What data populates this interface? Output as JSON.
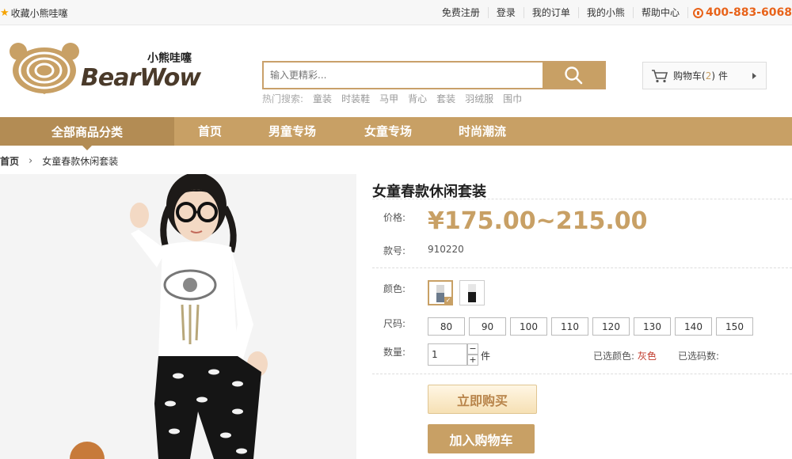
{
  "topbar": {
    "favorite": "收藏小熊哇噻",
    "links": [
      "免费注册",
      "登录",
      "我的订单",
      "我的小熊",
      "帮助中心"
    ],
    "phone": "400-883-6068"
  },
  "logo": {
    "brand": "BearWow",
    "cn": "小熊哇噻"
  },
  "search": {
    "placeholder": "输入更精彩...",
    "hot_label": "热门搜索:",
    "hot_keywords": [
      "童装",
      "时装鞋",
      "马甲",
      "背心",
      "套装",
      "羽绒服",
      "围巾"
    ]
  },
  "cart": {
    "label": "购物车",
    "count": "2",
    "unit": "件"
  },
  "nav": {
    "all": "全部商品分类",
    "items": [
      "首页",
      "男童专场",
      "女童专场",
      "时尚潮流"
    ]
  },
  "breadcrumb": {
    "home": "首页",
    "current": "女童春款休闲套装"
  },
  "product": {
    "title": "女童春款休闲套装",
    "price_label": "价格:",
    "price": "¥175.00~215.00",
    "code_label": "款号:",
    "code": "910220",
    "color_label": "颜色:",
    "size_label": "尺码:",
    "sizes": [
      "80",
      "90",
      "100",
      "110",
      "120",
      "130",
      "140",
      "150"
    ],
    "qty_label": "数量:",
    "qty": "1",
    "qty_unit": "件",
    "selected_color_label": "已选颜色:",
    "selected_color": "灰色",
    "selected_size_label": "已选码数:",
    "buy_now": "立即购买",
    "add_to_cart": "加入购物车"
  },
  "colors": {
    "accent": "#c8a065",
    "accent_dark": "#b38c54",
    "phone": "#e8631a"
  }
}
